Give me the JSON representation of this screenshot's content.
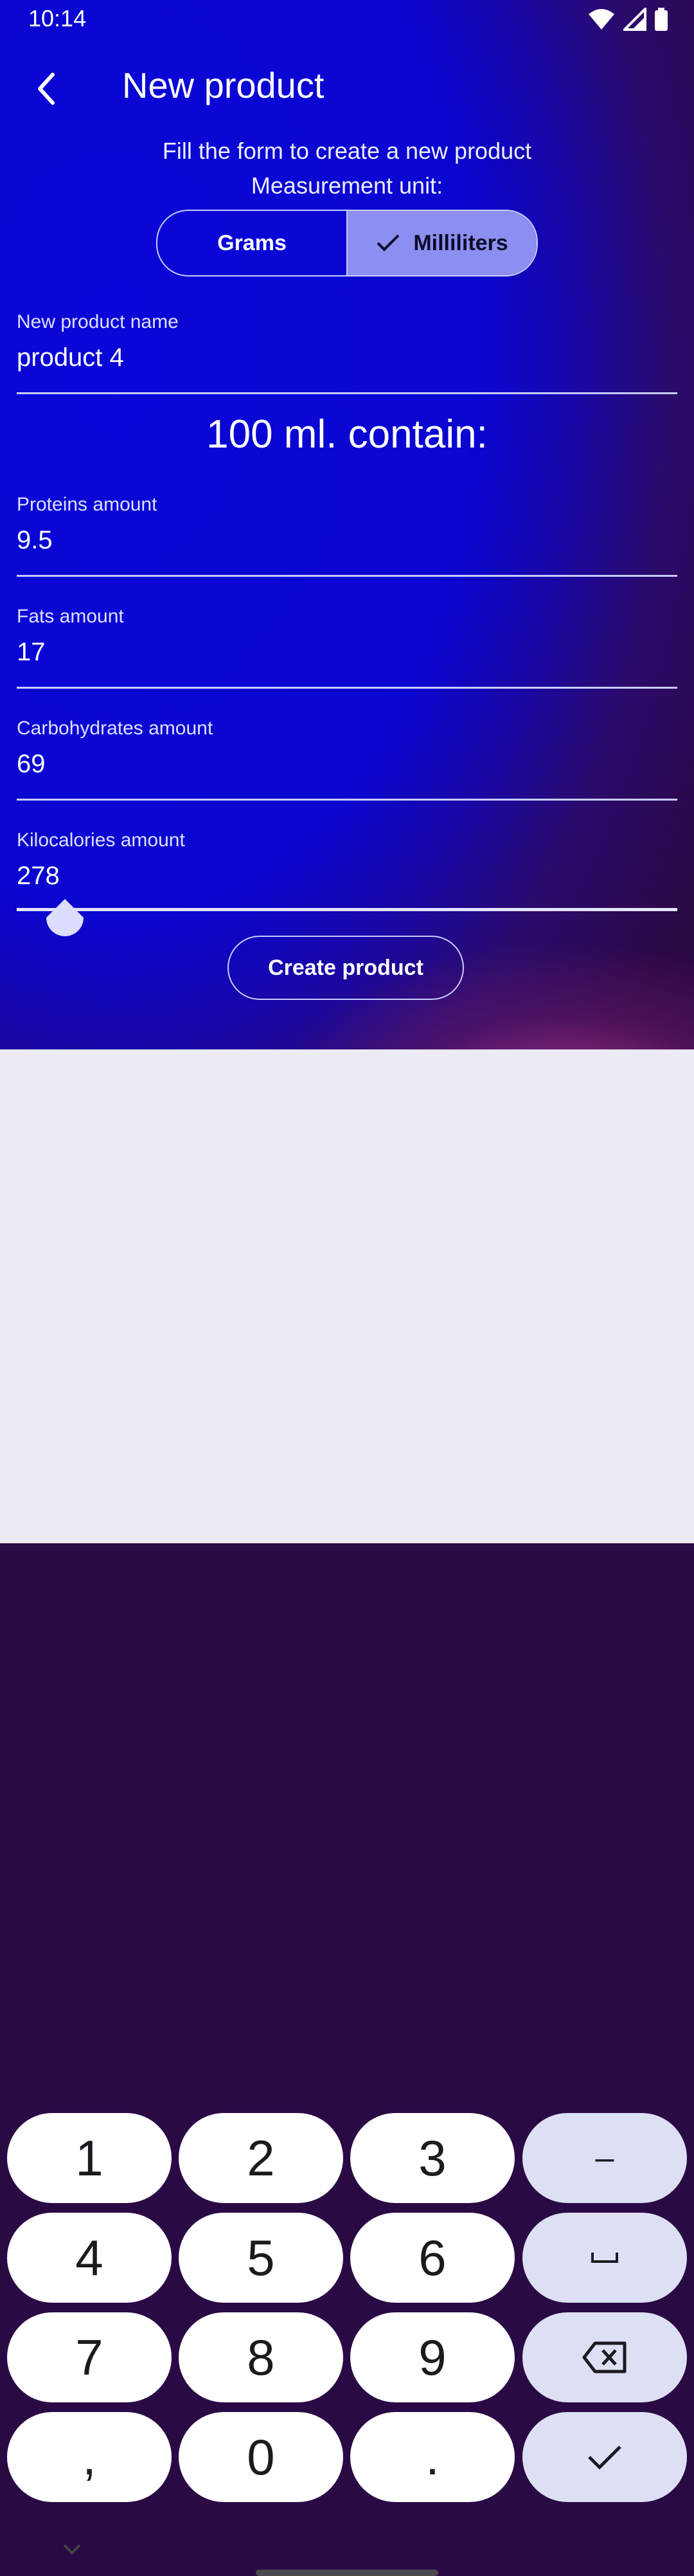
{
  "status_bar": {
    "time": "10:14",
    "icons": [
      "wifi-icon",
      "cellular-signal-icon",
      "battery-icon"
    ]
  },
  "app_bar": {
    "title": "New product",
    "back_icon": "arrow-back-icon"
  },
  "form": {
    "hint": "Fill the form to create a new product",
    "unit_label": "Measurement unit:",
    "unit_options": [
      "Grams",
      "Milliliters"
    ],
    "selected_unit": "Milliliters",
    "name_field": {
      "label": "New product name",
      "value": "product 4"
    },
    "contain_heading": "100 ml. contain:",
    "proteins": {
      "label": "Proteins amount",
      "value": "9.5"
    },
    "fats": {
      "label": "Fats amount",
      "value": "17"
    },
    "carbs": {
      "label": "Carbohydrates amount",
      "value": "69"
    },
    "kcal": {
      "label": "Kilocalories amount",
      "value": "278"
    },
    "create_button": "Create product"
  },
  "keyboard": {
    "rows": [
      [
        "1",
        "2",
        "3",
        "–"
      ],
      [
        "4",
        "5",
        "6",
        "␣"
      ],
      [
        "7",
        "8",
        "9",
        "⌫"
      ],
      [
        ",",
        "0",
        ".",
        "✓"
      ]
    ],
    "hide_icon": "chevron-down-icon"
  },
  "colors": {
    "accent": "#8c8ff0",
    "background": "#0b06cf",
    "outline": "#c9ccff"
  }
}
